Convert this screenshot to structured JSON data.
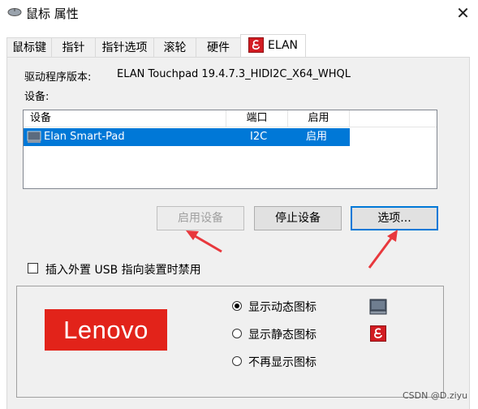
{
  "window": {
    "title": "鼠标 属性",
    "close_glyph": "✕"
  },
  "tabs": [
    {
      "label": "鼠标键"
    },
    {
      "label": "指针"
    },
    {
      "label": "指针选项"
    },
    {
      "label": "滚轮"
    },
    {
      "label": "硬件"
    },
    {
      "label": "ELAN",
      "active": true
    }
  ],
  "driver": {
    "label": "驱动程序版本:",
    "value": "ELAN Touchpad 19.4.7.3_HIDI2C_X64_WHQL"
  },
  "devices": {
    "label": "设备:",
    "columns": [
      "设备",
      "端口",
      "启用"
    ],
    "rows": [
      {
        "name": "Elan Smart-Pad",
        "port": "I2C",
        "enabled": "启用",
        "selected": true
      }
    ]
  },
  "buttons": {
    "enable": "启用设备",
    "disable": "停止设备",
    "options": "选项..."
  },
  "usb_disable": {
    "label": "插入外置 USB 指向装置时禁用",
    "checked": false
  },
  "logo": {
    "text": "Lenovo",
    "color": "#e2231a"
  },
  "tray_icon": {
    "options": [
      {
        "label": "显示动态图标",
        "selected": true,
        "icon": "touchpad-icon"
      },
      {
        "label": "显示静态图标",
        "selected": false,
        "icon": "elan-icon"
      },
      {
        "label": "不再显示图标",
        "selected": false
      }
    ]
  },
  "watermark": "CSDN @D.ziyu",
  "colors": {
    "selection": "#0078d7",
    "annotation_arrow": "#e8383d",
    "brand": "#e2231a"
  }
}
